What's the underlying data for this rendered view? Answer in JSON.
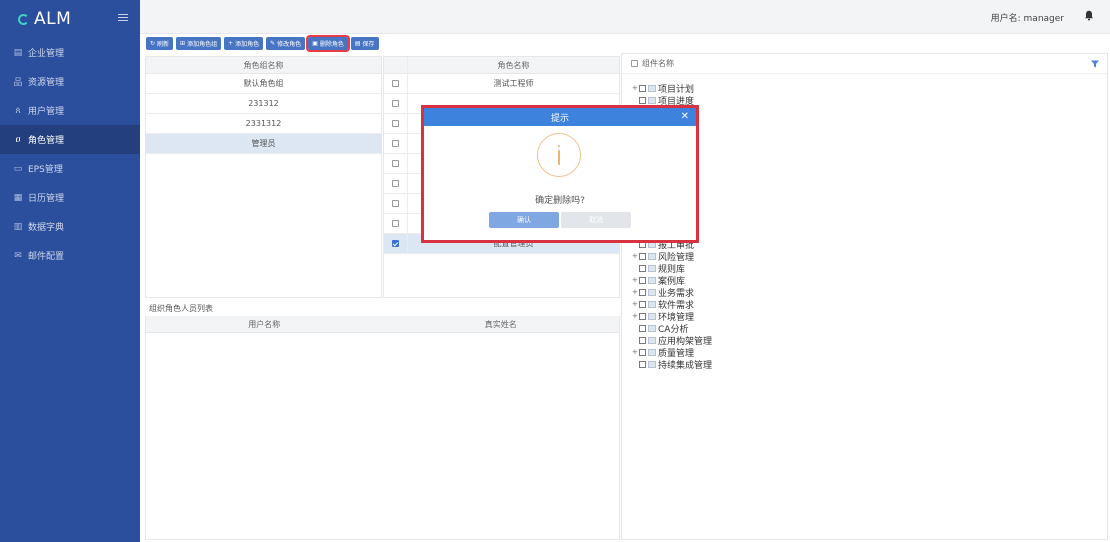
{
  "app": {
    "logo": "ALM"
  },
  "sidebar": {
    "items": [
      {
        "label": "企业管理",
        "icon": "building-icon",
        "glyph": "▤",
        "active": false
      },
      {
        "label": "资源管理",
        "icon": "org-icon",
        "glyph": "品",
        "active": false
      },
      {
        "label": "用户管理",
        "icon": "users-icon",
        "glyph": "ጰ",
        "active": false
      },
      {
        "label": "角色管理",
        "icon": "user-icon",
        "glyph": "ዐ",
        "active": true
      },
      {
        "label": "EPS管理",
        "icon": "folder-icon",
        "glyph": "▭",
        "active": false
      },
      {
        "label": "日历管理",
        "icon": "calendar-icon",
        "glyph": "▦",
        "active": false
      },
      {
        "label": "数据字典",
        "icon": "dictionary-icon",
        "glyph": "▥",
        "active": false
      },
      {
        "label": "邮件配置",
        "icon": "mail-icon",
        "glyph": "✉",
        "active": false
      }
    ]
  },
  "header": {
    "user_label": "用户名: manager"
  },
  "toolbar": {
    "refresh": "刷新",
    "add_group": "添加角色组",
    "add_role": "添加角色",
    "edit_role": "修改角色",
    "delete_role": "删除角色",
    "save": "保存"
  },
  "groups": {
    "header": "角色组名称",
    "rows": [
      "默认角色组",
      "231312",
      "2331312",
      "管理员"
    ],
    "selected_index": 3
  },
  "roles": {
    "header": "角色名称",
    "rows": [
      {
        "name": "测试工程师",
        "checked": false
      },
      {
        "name": "",
        "checked": false
      },
      {
        "name": "",
        "checked": false
      },
      {
        "name": "",
        "checked": false
      },
      {
        "name": "",
        "checked": false
      },
      {
        "name": "",
        "checked": false
      },
      {
        "name": "",
        "checked": false
      },
      {
        "name": "",
        "checked": false
      },
      {
        "name": "配置管理员",
        "checked": true
      }
    ]
  },
  "members": {
    "title": "组织角色人员列表",
    "col_user": "用户名称",
    "col_real": "真实姓名"
  },
  "components": {
    "header": "组件名称",
    "nodes": [
      {
        "label": "项目计划",
        "expandable": true
      },
      {
        "label": "项目进度",
        "expandable": false
      },
      {
        "label": "",
        "expandable": false
      },
      {
        "label": "",
        "expandable": false
      },
      {
        "label": "",
        "expandable": false
      },
      {
        "label": "",
        "expandable": false
      },
      {
        "label": "",
        "expandable": false
      },
      {
        "label": "",
        "expandable": false
      },
      {
        "label": "",
        "expandable": false
      },
      {
        "label": "",
        "expandable": false
      },
      {
        "label": "",
        "expandable": false
      },
      {
        "label": "",
        "expandable": false
      },
      {
        "label": "",
        "expandable": false
      },
      {
        "label": "报工审批",
        "expandable": false
      },
      {
        "label": "风险管理",
        "expandable": true
      },
      {
        "label": "规则库",
        "expandable": false
      },
      {
        "label": "案例库",
        "expandable": true
      },
      {
        "label": "业务需求",
        "expandable": true
      },
      {
        "label": "软件需求",
        "expandable": true
      },
      {
        "label": "环境管理",
        "expandable": true
      },
      {
        "label": "CA分析",
        "expandable": false
      },
      {
        "label": "应用构架管理",
        "expandable": false
      },
      {
        "label": "质量管理",
        "expandable": true
      },
      {
        "label": "持续集成管理",
        "expandable": false
      }
    ]
  },
  "dialog": {
    "title": "提示",
    "message": "确定删除吗?",
    "ok": "确认",
    "cancel": "取消"
  }
}
